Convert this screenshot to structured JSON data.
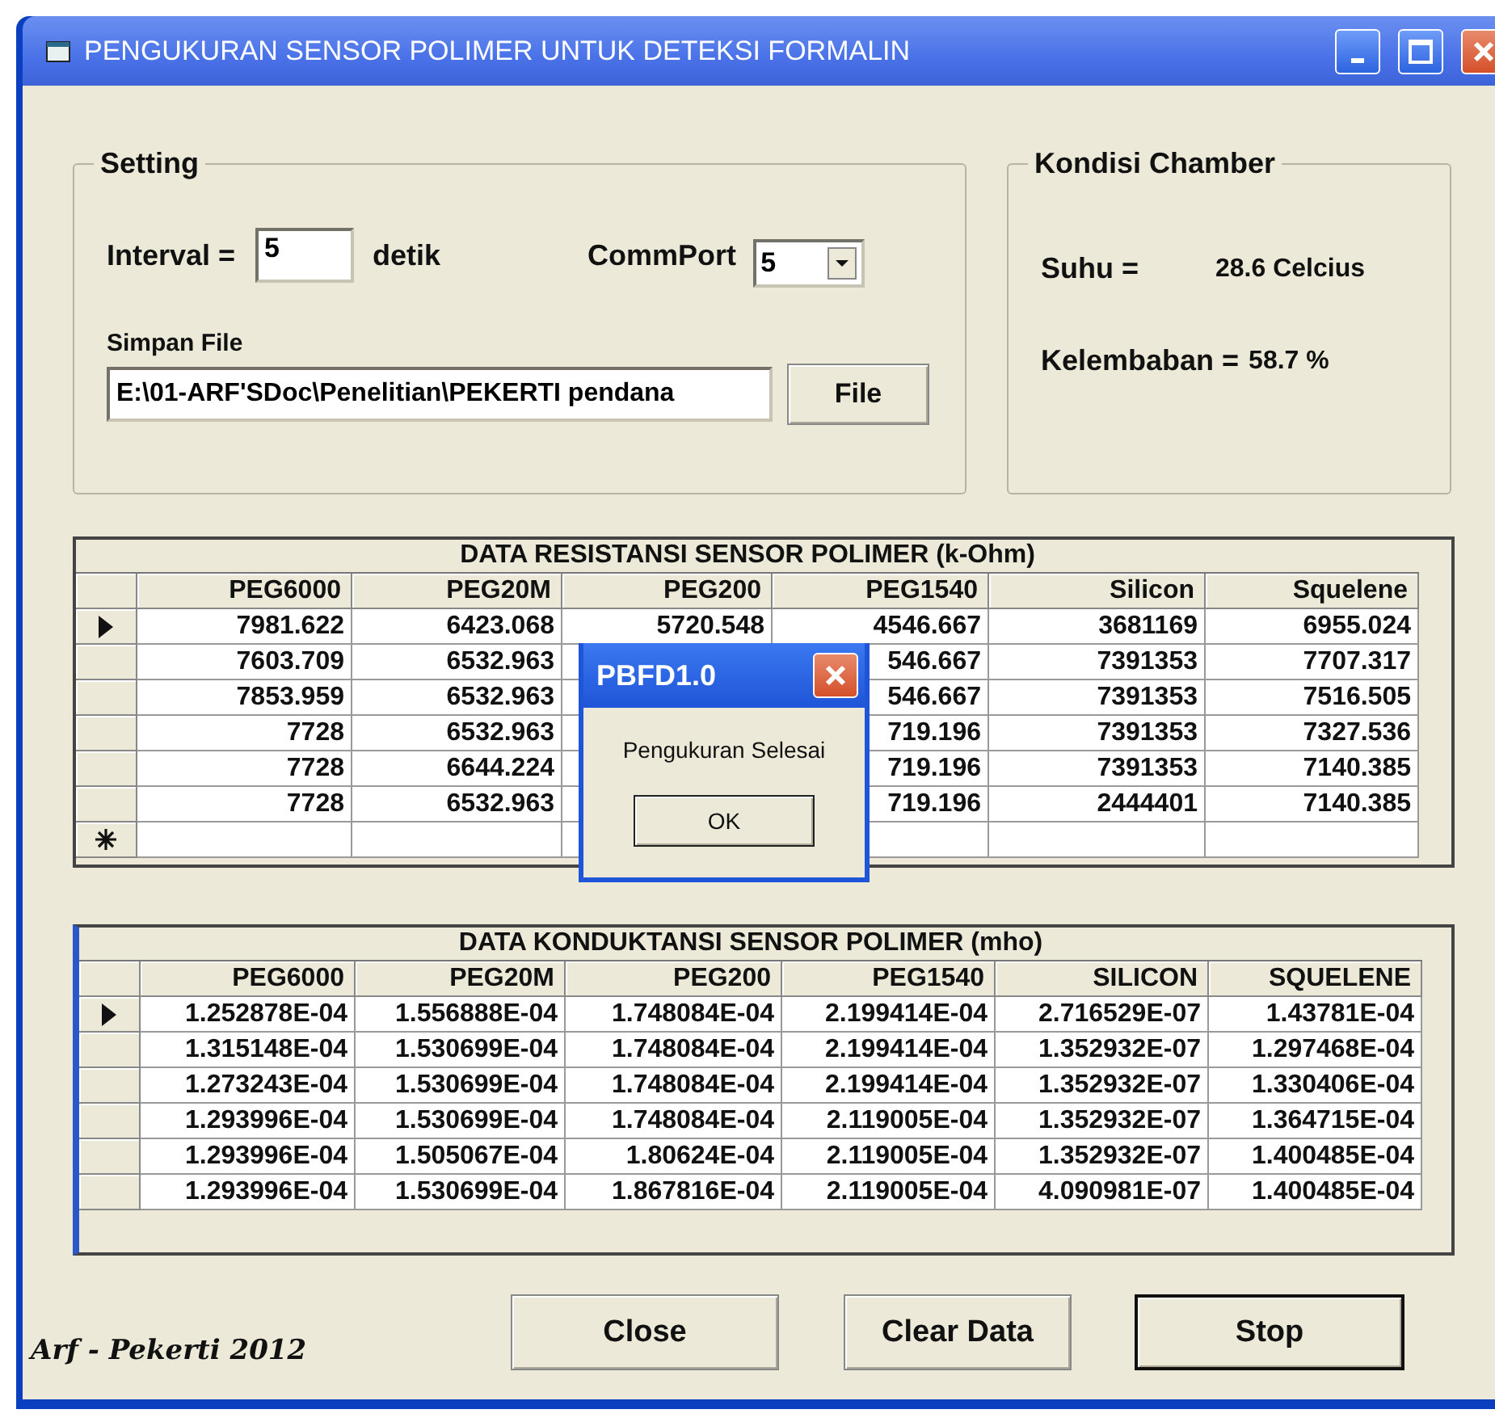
{
  "window": {
    "title": "PENGUKURAN SENSOR POLIMER UNTUK DETEKSI FORMALIN"
  },
  "setting": {
    "title": "Setting",
    "interval_label": "Interval =",
    "interval_value": "5",
    "interval_unit": "detik",
    "commport_label": "CommPort",
    "commport_value": "5",
    "file_label": "Simpan File",
    "file_path": "E:\\01-ARF'SDoc\\Penelitian\\PEKERTI pendana",
    "file_button": "File"
  },
  "chamber": {
    "title": "Kondisi Chamber",
    "suhu_label": "Suhu =",
    "suhu_value": "28.6 Celcius",
    "kelembaban_label": "Kelembaban =",
    "kelembaban_value": "58.7 %"
  },
  "resistance_table": {
    "title": "DATA RESISTANSI SENSOR POLIMER (k-Ohm)",
    "columns": [
      "PEG6000",
      "PEG20M",
      "PEG200",
      "PEG1540",
      "Silicon",
      "Squelene"
    ],
    "rows": [
      {
        "kind": "data",
        "selected": true,
        "cells": [
          "7981.622",
          "6423.068",
          "5720.548",
          "4546.667",
          "3681169",
          "6955.024"
        ]
      },
      {
        "kind": "data",
        "selected": false,
        "cells": [
          "7603.709",
          "6532.963",
          null,
          "546.667",
          "7391353",
          "7707.317"
        ]
      },
      {
        "kind": "data",
        "selected": false,
        "cells": [
          "7853.959",
          "6532.963",
          null,
          "546.667",
          "7391353",
          "7516.505"
        ]
      },
      {
        "kind": "data",
        "selected": false,
        "cells": [
          "7728",
          "6532.963",
          null,
          "719.196",
          "7391353",
          "7327.536"
        ]
      },
      {
        "kind": "data",
        "selected": false,
        "cells": [
          "7728",
          "6644.224",
          null,
          "719.196",
          "7391353",
          "7140.385"
        ]
      },
      {
        "kind": "data",
        "selected": false,
        "cells": [
          "7728",
          "6532.963",
          null,
          "719.196",
          "2444401",
          "7140.385"
        ]
      },
      {
        "kind": "new"
      }
    ]
  },
  "conductance_table": {
    "title": "DATA KONDUKTANSI SENSOR POLIMER (mho)",
    "columns": [
      "PEG6000",
      "PEG20M",
      "PEG200",
      "PEG1540",
      "SILICON",
      "SQUELENE"
    ],
    "rows": [
      {
        "kind": "data",
        "selected": true,
        "cells": [
          "1.252878E-04",
          "1.556888E-04",
          "1.748084E-04",
          "2.199414E-04",
          "2.716529E-07",
          "1.43781E-04"
        ]
      },
      {
        "kind": "data",
        "selected": false,
        "cells": [
          "1.315148E-04",
          "1.530699E-04",
          "1.748084E-04",
          "2.199414E-04",
          "1.352932E-07",
          "1.297468E-04"
        ]
      },
      {
        "kind": "data",
        "selected": false,
        "cells": [
          "1.273243E-04",
          "1.530699E-04",
          "1.748084E-04",
          "2.199414E-04",
          "1.352932E-07",
          "1.330406E-04"
        ]
      },
      {
        "kind": "data",
        "selected": false,
        "cells": [
          "1.293996E-04",
          "1.530699E-04",
          "1.748084E-04",
          "2.119005E-04",
          "1.352932E-07",
          "1.364715E-04"
        ]
      },
      {
        "kind": "data",
        "selected": false,
        "cells": [
          "1.293996E-04",
          "1.505067E-04",
          "1.80624E-04",
          "2.119005E-04",
          "1.352932E-07",
          "1.400485E-04"
        ]
      },
      {
        "kind": "data",
        "selected": false,
        "cells": [
          "1.293996E-04",
          "1.530699E-04",
          "1.867816E-04",
          "2.119005E-04",
          "4.090981E-07",
          "1.400485E-04"
        ]
      }
    ]
  },
  "dialog": {
    "title": "PBFD1.0",
    "message": "Pengukuran Selesai",
    "button": "OK"
  },
  "buttons": [
    {
      "label": "Close",
      "default": false
    },
    {
      "label": "Clear Data",
      "default": false
    },
    {
      "label": "Stop",
      "default": true
    }
  ],
  "signature": "Arf - Pekerti 2012"
}
